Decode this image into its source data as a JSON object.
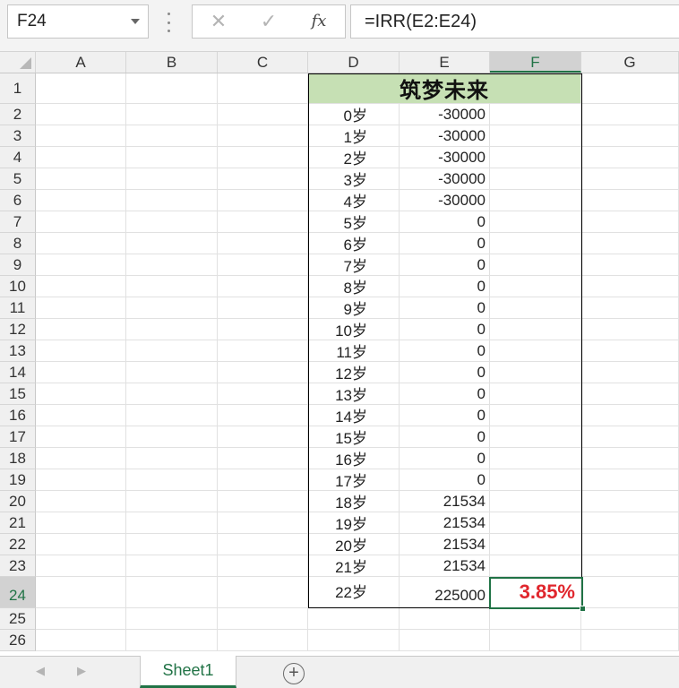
{
  "name_box": {
    "value": "F24"
  },
  "formula_bar": {
    "cancel_glyph": "✕",
    "enter_glyph": "✓",
    "fx_glyph": "fx",
    "formula": "=IRR(E2:E24)"
  },
  "columns": [
    "A",
    "B",
    "C",
    "D",
    "E",
    "F",
    "G"
  ],
  "selected_column": "F",
  "selected_row": 24,
  "title": "筑梦未来",
  "rows": [
    {
      "n": "1"
    },
    {
      "n": "2",
      "age": "0岁",
      "value": "-30000"
    },
    {
      "n": "3",
      "age": "1岁",
      "value": "-30000"
    },
    {
      "n": "4",
      "age": "2岁",
      "value": "-30000"
    },
    {
      "n": "5",
      "age": "3岁",
      "value": "-30000"
    },
    {
      "n": "6",
      "age": "4岁",
      "value": "-30000"
    },
    {
      "n": "7",
      "age": "5岁",
      "value": "0"
    },
    {
      "n": "8",
      "age": "6岁",
      "value": "0"
    },
    {
      "n": "9",
      "age": "7岁",
      "value": "0"
    },
    {
      "n": "10",
      "age": "8岁",
      "value": "0"
    },
    {
      "n": "11",
      "age": "9岁",
      "value": "0"
    },
    {
      "n": "12",
      "age": "10岁",
      "value": "0"
    },
    {
      "n": "13",
      "age": "11岁",
      "value": "0"
    },
    {
      "n": "14",
      "age": "12岁",
      "value": "0"
    },
    {
      "n": "15",
      "age": "13岁",
      "value": "0"
    },
    {
      "n": "16",
      "age": "14岁",
      "value": "0"
    },
    {
      "n": "17",
      "age": "15岁",
      "value": "0"
    },
    {
      "n": "18",
      "age": "16岁",
      "value": "0"
    },
    {
      "n": "19",
      "age": "17岁",
      "value": "0"
    },
    {
      "n": "20",
      "age": "18岁",
      "value": "21534"
    },
    {
      "n": "21",
      "age": "19岁",
      "value": "21534"
    },
    {
      "n": "22",
      "age": "20岁",
      "value": "21534"
    },
    {
      "n": "23",
      "age": "21岁",
      "value": "21534"
    },
    {
      "n": "24",
      "age": "22岁",
      "value": "225000",
      "result": "3.85%"
    },
    {
      "n": "25"
    },
    {
      "n": "26"
    }
  ],
  "colors": {
    "title_fill": "#c6e0b4",
    "result_text": "#e0262d",
    "selection": "#217346"
  },
  "sheets": {
    "nav_prev": "◀",
    "nav_next": "▶",
    "tabs": [
      "Sheet1"
    ],
    "add_glyph": "+"
  }
}
